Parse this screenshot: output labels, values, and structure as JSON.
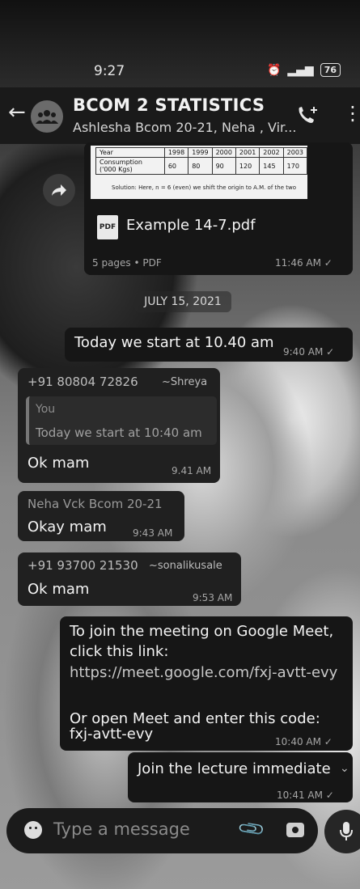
{
  "status": {
    "time": "9:27",
    "battery": "76"
  },
  "header": {
    "title": "BCOM 2 STATISTICS",
    "subtitle": "Ashlesha Bcom 20-21, Neha , Vir..."
  },
  "attachment": {
    "table_header": [
      "Year",
      "1998",
      "1999",
      "2000",
      "2001",
      "2002",
      "2003"
    ],
    "table_row_label": "Consumption ('000 Kgs)",
    "table_row": [
      "60",
      "80",
      "90",
      "120",
      "145",
      "170"
    ],
    "solution_line": "Solution: Here, n = 6 (even) we shift the origin to A.M. of the two",
    "pdf_badge": "PDF",
    "file_name": "Example 14-7.pdf",
    "details": "5 pages • PDF",
    "time": "11:46 AM ✓"
  },
  "date_chip": "JULY 15, 2021",
  "messages": [
    {
      "text": "Today we start at 10.40 am",
      "time": "9:40 AM ✓"
    },
    {
      "sender": "+91 80804 72826",
      "alias": "~Shreya",
      "quote_author": "You",
      "quote_text": "Today we start at 10:40 am",
      "text": "Ok mam",
      "time": "9.41 AM"
    },
    {
      "sender": "Neha Vck Bcom 20-21",
      "text": "Okay mam",
      "time": "9:43 AM"
    },
    {
      "sender": "+91 93700 21530",
      "alias": "~sonalikusale",
      "text": "Ok mam",
      "time": "9:53 AM"
    },
    {
      "line1": "To join the meeting on Google Meet,",
      "line2": "click this link:",
      "link": "https://meet.google.com/fxj-avtt-evy",
      "line3": "Or open Meet and enter this code:",
      "code": "fxj-avtt-evy",
      "time": "10:40 AM ✓"
    },
    {
      "text": "Join the lecture immediate",
      "time": "10:41 AM ✓"
    }
  ],
  "composer": {
    "placeholder": "Type a message"
  }
}
